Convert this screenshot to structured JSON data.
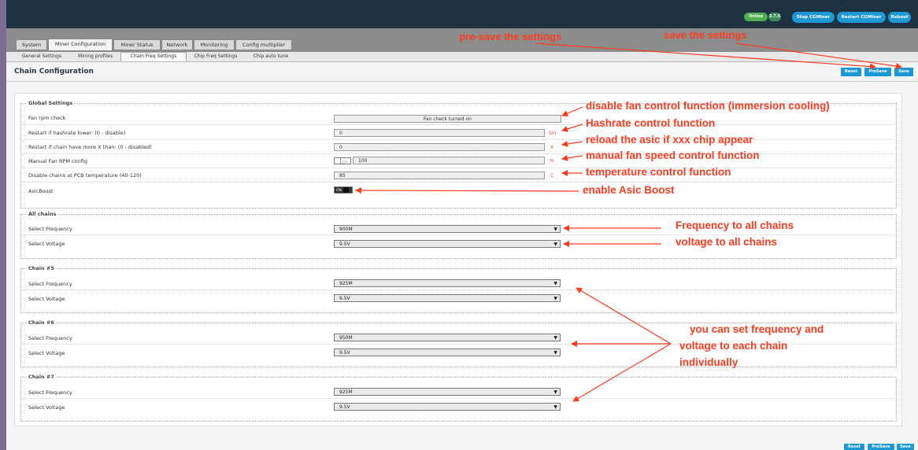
{
  "header": {
    "status_badge": "Online",
    "version_badge": "3.7.5",
    "stop_button": "Stop CGMiner",
    "restart_button": "Restart CGMiner",
    "reboot_button": "Reboot"
  },
  "tabs": [
    "System",
    "Miner Configuration",
    "Miner Status",
    "Network",
    "Monitoring",
    "Config multiplier"
  ],
  "subtabs": [
    "General Settings",
    "Mining profiles",
    "Chain Freq Settings",
    "Chip Freq Settings",
    "Chip auto tune"
  ],
  "page": {
    "title": "Chain Configuration",
    "reset": "Reset",
    "presave": "PreSave",
    "save": "Save"
  },
  "global": {
    "legend": "Global Settings",
    "fan_rpm_check": {
      "label": "Fan rpm check",
      "value": "Fan check turned on"
    },
    "restart_hashrate": {
      "label": "Restart if hashrate lower: (0 - disable)",
      "value": "0",
      "unit": "GH"
    },
    "restart_chain": {
      "label": "Restart if chain have more X than: (0 - disabled)",
      "value": "0",
      "unit": "X"
    },
    "manual_fan": {
      "label": "Manual Fan RPM config",
      "toggle": "OFF",
      "value": "100",
      "unit": "%"
    },
    "disable_temp": {
      "label": "Disable chains at PCB temperature (40-120)",
      "value": "85",
      "unit": "C"
    },
    "asicboost": {
      "label": "AsicBoost",
      "toggle": "ON"
    }
  },
  "all_chains": {
    "legend": "All chains",
    "freq_label": "Select Frequency",
    "freq": "900M",
    "volt_label": "Select Voltage",
    "volt": "9.5V"
  },
  "chains": [
    {
      "legend": "Chain #5",
      "freq_label": "Select Frequency",
      "freq": "925M",
      "volt_label": "Select Voltage",
      "volt": "9.5V"
    },
    {
      "legend": "Chain #6",
      "freq_label": "Select Frequency",
      "freq": "950M",
      "volt_label": "Select Voltage",
      "volt": "9.5V"
    },
    {
      "legend": "Chain #7",
      "freq_label": "Select Frequency",
      "freq": "925M",
      "volt_label": "Select Voltage",
      "volt": "9.5V"
    }
  ],
  "annotations": {
    "presave": "pre-save the settings",
    "save": "save the settings",
    "fan": "disable fan control function (immersion cooling)",
    "hashrate": "Hashrate control function",
    "reload": "reload the asic if xxx chip appear",
    "manual_fan": "manual fan speed control function",
    "temperature": "temperature control function",
    "asicboost": "enable Asic Boost",
    "freq_all": "Frequency to all chains",
    "volt_all": "voltage to all chains",
    "each1": "you can set frequency and",
    "each2": "voltage to each chain",
    "each3": "individually"
  },
  "colors": {
    "accent": "#1d98d6",
    "annotation": "#ff3b1f",
    "topbar": "#1f3241",
    "online": "#4caf50"
  }
}
